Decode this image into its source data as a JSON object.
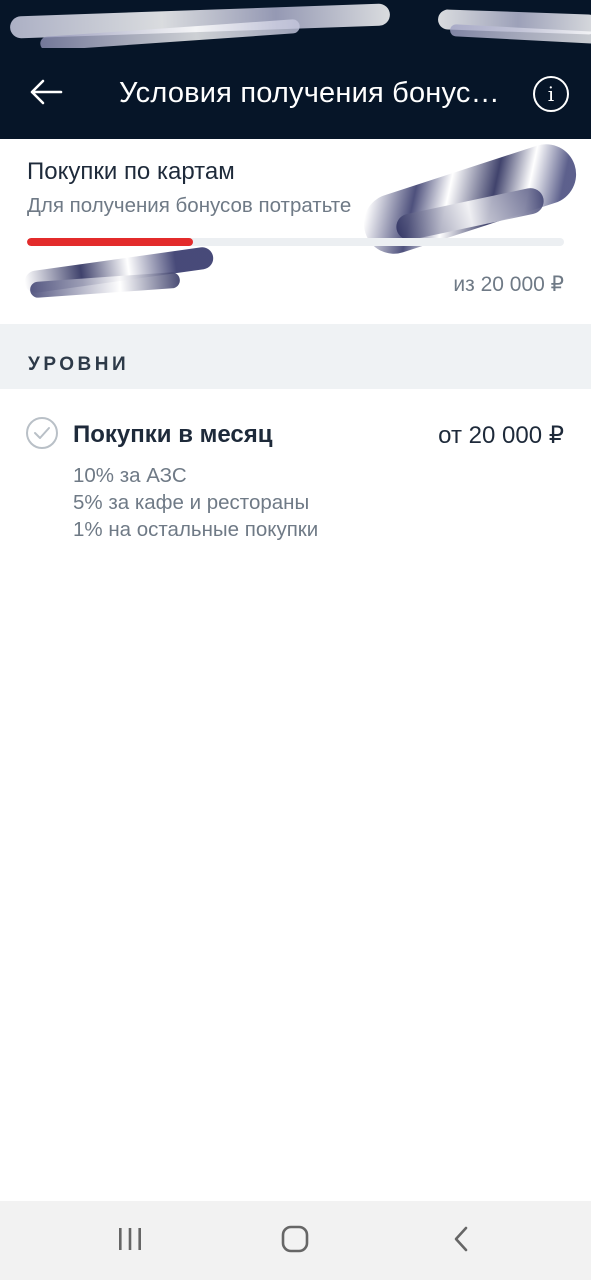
{
  "header": {
    "title": "Условия получения бонус…",
    "back_icon": "arrow-left-icon",
    "info_icon": "info-icon",
    "info_label": "i"
  },
  "progress_card": {
    "title": "Покупки по картам",
    "subtitle": "Для получения бонусов потратьте",
    "progress_fraction": 0.31,
    "total_label": "из 20 000 ₽",
    "accent_color": "#e32b2b"
  },
  "levels_section": {
    "title": "УРОВНИ",
    "levels": [
      {
        "name": "Покупки в месяц",
        "amount": "от 20 000 ₽",
        "benefits": [
          "10% за АЗС",
          "5% за кафе и рестораны",
          "1% на остальные покупки"
        ]
      }
    ]
  },
  "colors": {
    "header_bg": "#061528",
    "section_bg": "#eff2f4",
    "text_primary": "#1e2a3a",
    "text_secondary": "#6f7a86"
  },
  "system_nav": {
    "icons": [
      "recent-apps-icon",
      "home-icon",
      "back-icon"
    ]
  }
}
